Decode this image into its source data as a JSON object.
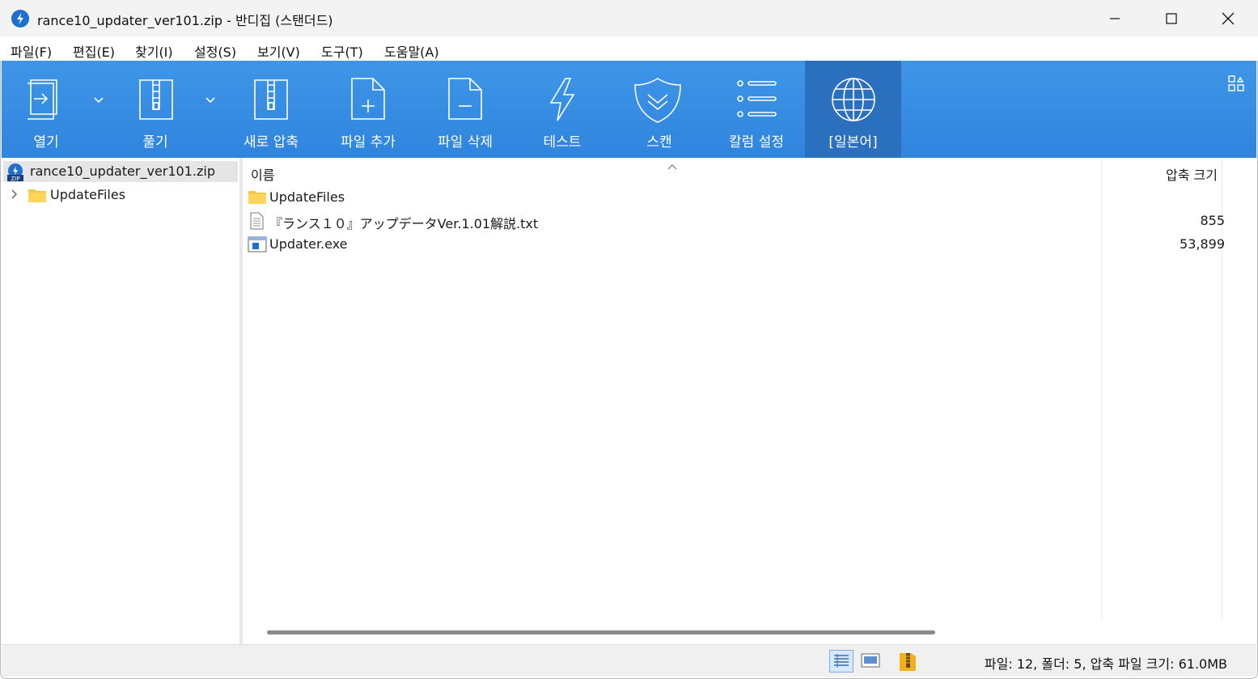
{
  "window": {
    "title": "rance10_updater_ver101.zip - 반디집 (스탠더드)",
    "app_icon": "bandizip-icon"
  },
  "menu": [
    "파일(F)",
    "편집(E)",
    "찾기(I)",
    "설정(S)",
    "보기(V)",
    "도구(T)",
    "도움말(A)"
  ],
  "toolbar": {
    "background": "#3a8fe2",
    "active_background": "#2b6fbf",
    "buttons": [
      {
        "label": "열기",
        "icon": "open-archive-icon",
        "has_dropdown": true
      },
      {
        "label": "풀기",
        "icon": "extract-icon",
        "has_dropdown": true
      },
      {
        "label": "새로 압축",
        "icon": "new-archive-icon",
        "has_dropdown": false
      },
      {
        "label": "파일 추가",
        "icon": "add-file-icon",
        "has_dropdown": false
      },
      {
        "label": "파일 삭제",
        "icon": "delete-file-icon",
        "has_dropdown": false
      },
      {
        "label": "테스트",
        "icon": "test-lightning-icon",
        "has_dropdown": false
      },
      {
        "label": "스캔",
        "icon": "scan-shield-icon",
        "has_dropdown": false
      },
      {
        "label": "칼럼 설정",
        "icon": "column-settings-icon",
        "has_dropdown": false
      },
      {
        "label": "[일본어]",
        "icon": "globe-icon",
        "has_dropdown": false,
        "active": true
      }
    ]
  },
  "tree": {
    "root": "rance10_updater_ver101.zip",
    "children": [
      "UpdateFiles"
    ]
  },
  "file_list": {
    "columns": {
      "name": "이름",
      "size": "압축 크기"
    },
    "rows": [
      {
        "name": "UpdateFiles",
        "size": "",
        "icon": "folder-icon"
      },
      {
        "name": "『ランス１０』アップデータVer.1.01解説.txt",
        "size": "855",
        "icon": "text-file-icon"
      },
      {
        "name": "Updater.exe",
        "size": "53,899",
        "icon": "exe-file-icon"
      }
    ]
  },
  "status": {
    "text": "파일: 12, 폴더: 5, 압축 파일 크기: 61.0MB"
  }
}
